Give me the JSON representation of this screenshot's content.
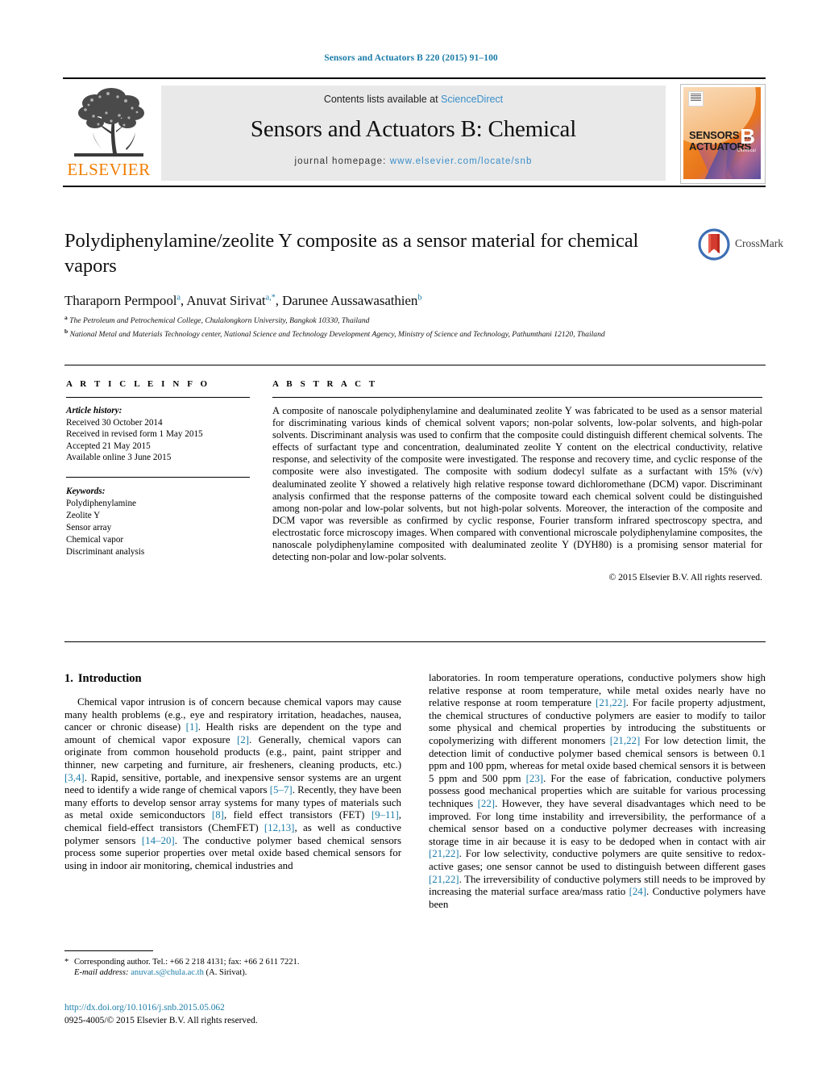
{
  "running_head": "Sensors and Actuators B 220 (2015) 91–100",
  "masthead": {
    "contents_prefix": "Contents lists available at ",
    "sciencedirect": "ScienceDirect",
    "journal_title": "Sensors and Actuators B: Chemical",
    "homepage_label": "journal homepage: ",
    "homepage_url": "www.elsevier.com/locate/snb",
    "publisher_logo_text": "ELSEVIER",
    "cover": {
      "line1": "SENSORS",
      "line1_small": "and",
      "line2": "ACTUATORS",
      "letter": "B",
      "letter_sub": "Chemical"
    }
  },
  "article": {
    "title": "Polydiphenylamine/zeolite Y composite as a sensor material for chemical vapors",
    "crossmark_label": "CrossMark",
    "authors_html": "Tharaporn Permpool<sup>a</sup>, Anuvat Sirivat<sup>a,<span class=\"star\">*</span></sup>, Darunee Aussawasathien<sup>b</sup>",
    "affiliations": [
      {
        "marker": "a",
        "text": "The Petroleum and Petrochemical College, Chulalongkorn University, Bangkok 10330, Thailand"
      },
      {
        "marker": "b",
        "text": "National Metal and Materials Technology center, National Science and Technology Development Agency, Ministry of Science and Technology, Pathumthani 12120, Thailand"
      }
    ]
  },
  "article_info": {
    "heading": "A R T I C L E   I N F O",
    "history_label": "Article history:",
    "history": [
      "Received 30 October 2014",
      "Received in revised form 1 May 2015",
      "Accepted 21 May 2015",
      "Available online 3 June 2015"
    ],
    "keywords_label": "Keywords:",
    "keywords": [
      "Polydiphenylamine",
      "Zeolite Y",
      "Sensor array",
      "Chemical vapor",
      "Discriminant analysis"
    ]
  },
  "abstract": {
    "heading": "A B S T R A C T",
    "text": "A composite of nanoscale polydiphenylamine and dealuminated zeolite Y was fabricated to be used as a sensor material for discriminating various kinds of chemical solvent vapors; non-polar solvents, low-polar solvents, and high-polar solvents. Discriminant analysis was used to confirm that the composite could distinguish different chemical solvents. The effects of surfactant type and concentration, dealuminated zeolite Y content on the electrical conductivity, relative response, and selectivity of the composite were investigated. The response and recovery time, and cyclic response of the composite were also investigated. The composite with sodium dodecyl sulfate as a surfactant with 15% (v/v) dealuminated zeolite Y showed a relatively high relative response toward dichloromethane (DCM) vapor. Discriminant analysis confirmed that the response patterns of the composite toward each chemical solvent could be distinguished among non-polar and low-polar solvents, but not high-polar solvents. Moreover, the interaction of the composite and DCM vapor was reversible as confirmed by cyclic response, Fourier transform infrared spectroscopy spectra, and electrostatic force microscopy images. When compared with conventional microscale polydiphenylamine composites, the nanoscale polydiphenylamine composited with dealuminated zeolite Y (DYH80) is a promising sensor material for detecting non-polar and low-polar solvents.",
    "copyright": "© 2015 Elsevier B.V. All rights reserved."
  },
  "body": {
    "section_number": "1.",
    "section_title": "Introduction",
    "left_paragraph_html": "Chemical vapor intrusion is of concern because chemical vapors may cause many health problems (e.g., eye and respiratory irritation, headaches, nausea, cancer or chronic disease) <span class=\"ref\">[1]</span>. Health risks are dependent on the type and amount of chemical vapor exposure <span class=\"ref\">[2]</span>. Generally, chemical vapors can originate from common household products (e.g., paint, paint stripper and thinner, new carpeting and furniture, air fresheners, cleaning products, etc.) <span class=\"ref\">[3,4]</span>. Rapid, sensitive, portable, and inexpensive sensor systems are an urgent need to identify a wide range of chemical vapors <span class=\"ref\">[5–7]</span>. Recently, they have been many efforts to develop sensor array systems for many types of materials such as metal oxide semiconductors <span class=\"ref\">[8]</span>, field effect transistors (FET) <span class=\"ref\">[9–11]</span>, chemical field-effect transistors (ChemFET) <span class=\"ref\">[12,13]</span>, as well as conductive polymer sensors <span class=\"ref\">[14–20]</span>. The conductive polymer based chemical sensors process some superior properties over metal oxide based chemical sensors for using in indoor air monitoring, chemical industries and",
    "right_paragraph_html": "laboratories. In room temperature operations, conductive polymers show high relative response at room temperature, while metal oxides nearly have no relative response at room temperature <span class=\"ref\">[21,22]</span>. For facile property adjustment, the chemical structures of conductive polymers are easier to modify to tailor some physical and chemical properties by introducing the substituents or copolymerizing with different monomers <span class=\"ref\">[21,22]</span> For low detection limit, the detection limit of conductive polymer based chemical sensors is between 0.1 ppm and 100 ppm, whereas for metal oxide based chemical sensors it is between 5 ppm and 500 ppm <span class=\"ref\">[23]</span>. For the ease of fabrication, conductive polymers possess good mechanical properties which are suitable for various processing techniques <span class=\"ref\">[22]</span>. However, they have several disadvantages which need to be improved. For long time instability and irreversibility, the performance of a chemical sensor based on a conductive polymer decreases with increasing storage time in air because it is easy to be dedoped when in contact with air <span class=\"ref\">[21,22]</span>. For low selectivity, conductive polymers are quite sensitive to redox-active gases; one sensor cannot be used to distinguish between different gases <span class=\"ref\">[21,22]</span>. The irreversibility of conductive polymers still needs to be improved by increasing the material surface area/mass ratio <span class=\"ref\">[24]</span>. Conductive polymers have been"
  },
  "footer": {
    "corresponding_html": "<span class=\"star\">*</span> Corresponding author. Tel.: +66 2 218 4131; fax: +66 2 611 7221.",
    "email_label": "E-mail address:",
    "email": "anuvat.s@chula.ac.th",
    "email_suffix": "(A. Sirivat).",
    "doi": "http://dx.doi.org/10.1016/j.snb.2015.05.062",
    "issn_line": "0925-4005/© 2015 Elsevier B.V. All rights reserved."
  },
  "colors": {
    "link": "#1b7ca8",
    "sciencedirect": "#3a8ec9",
    "elsevier_orange": "#f07d00",
    "bar_bg": "#e9e9e9"
  }
}
